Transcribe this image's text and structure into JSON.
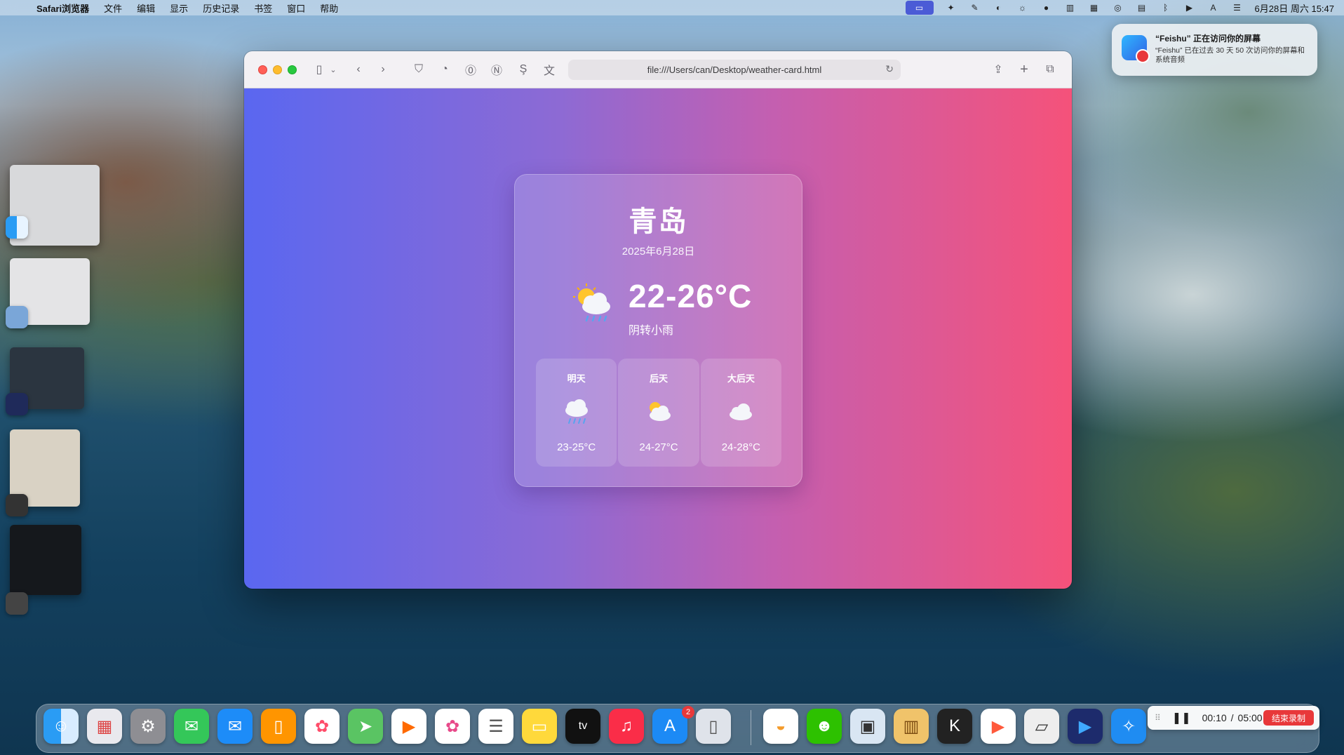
{
  "menubar": {
    "app_name": "Safari浏览器",
    "items": [
      "文件",
      "编辑",
      "显示",
      "历史记录",
      "书签",
      "窗口",
      "帮助"
    ],
    "datetime": "6月28日 周六 15:47"
  },
  "notification": {
    "title": "“Feishu” 正在访问你的屏幕",
    "body": "“Feishu” 已在过去 30 天 50 次访问你的屏幕和系统音频"
  },
  "browser": {
    "url": "file:///Users/can/Desktop/weather-card.html"
  },
  "weather": {
    "city": "青岛",
    "date": "2025年6月28日",
    "temp": "22-26°C",
    "condition": "阴转小雨",
    "current_icon": "sun-cloud-rain-icon",
    "forecast": [
      {
        "day": "明天",
        "temp": "23-25°C",
        "icon": "cloud-rain-icon"
      },
      {
        "day": "后天",
        "temp": "24-27°C",
        "icon": "sun-behind-cloud-icon"
      },
      {
        "day": "大后天",
        "temp": "24-28°C",
        "icon": "cloud-icon"
      }
    ]
  },
  "dock": {
    "appstore_badge": "2"
  },
  "recorder": {
    "time": "00:10",
    "total": "05:00",
    "stop_label": "结束录制"
  },
  "colors": {
    "gradient_start": "#5a67f0",
    "gradient_end": "#f5527a"
  }
}
